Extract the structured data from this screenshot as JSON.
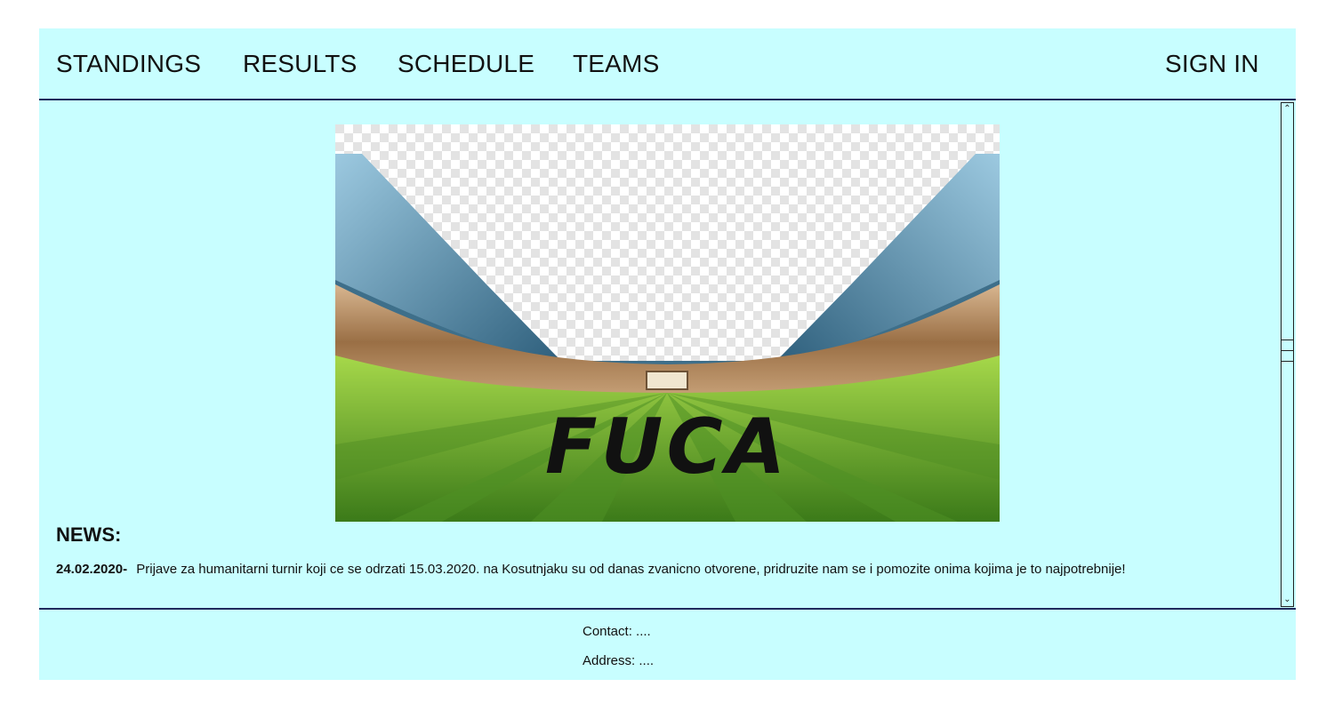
{
  "nav": {
    "items": [
      {
        "label": "STANDINGS"
      },
      {
        "label": "RESULTS"
      },
      {
        "label": "SCHEDULE"
      },
      {
        "label": "TEAMS"
      }
    ],
    "sign_in": "SIGN IN"
  },
  "banner": {
    "logo_text": "FUCA",
    "logo_color": "#111111"
  },
  "news": {
    "heading": "NEWS:",
    "items": [
      {
        "date": "24.02.2020-",
        "text": "Prijave za humanitarni turnir koji ce se odrzati 15.03.2020. na Kosutnjaku su od danas zvanicno otvorene, pridruzite nam se i pomozite onima kojima je to najpotrebnije!"
      }
    ]
  },
  "footer": {
    "contact": "Contact: ....",
    "address": "Address: ...."
  },
  "colors": {
    "panel": "#c8feff",
    "border": "#1f2a5c",
    "grass_light": "#7fc43a",
    "grass_dark": "#3f7f1c",
    "stands_roof": "#4f8fb0",
    "crowd": "#b08a5a"
  },
  "icons": {
    "scroll_up": "chevron-up-icon",
    "scroll_down": "chevron-down-icon"
  }
}
